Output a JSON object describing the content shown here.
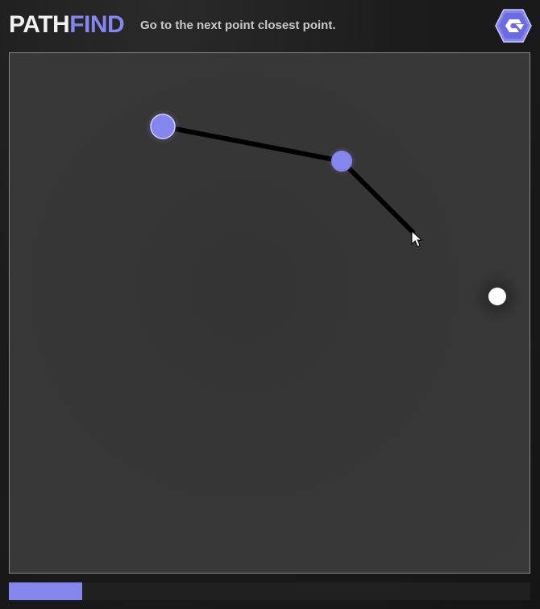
{
  "header": {
    "title_part1": "PATH",
    "title_part2": "FIND",
    "instruction": "Go to the next point closest point."
  },
  "colors": {
    "accent": "#8585ee",
    "background": "#1a1a1a",
    "board": "#383838",
    "path": "#000000",
    "target_point": "#ffffff"
  },
  "game": {
    "visited_points": 2,
    "remaining_points": 1,
    "progress_fraction": 0.14
  },
  "icons": {
    "logo": "hexagon-refresh-icon",
    "cursor": "mouse-pointer-icon"
  }
}
